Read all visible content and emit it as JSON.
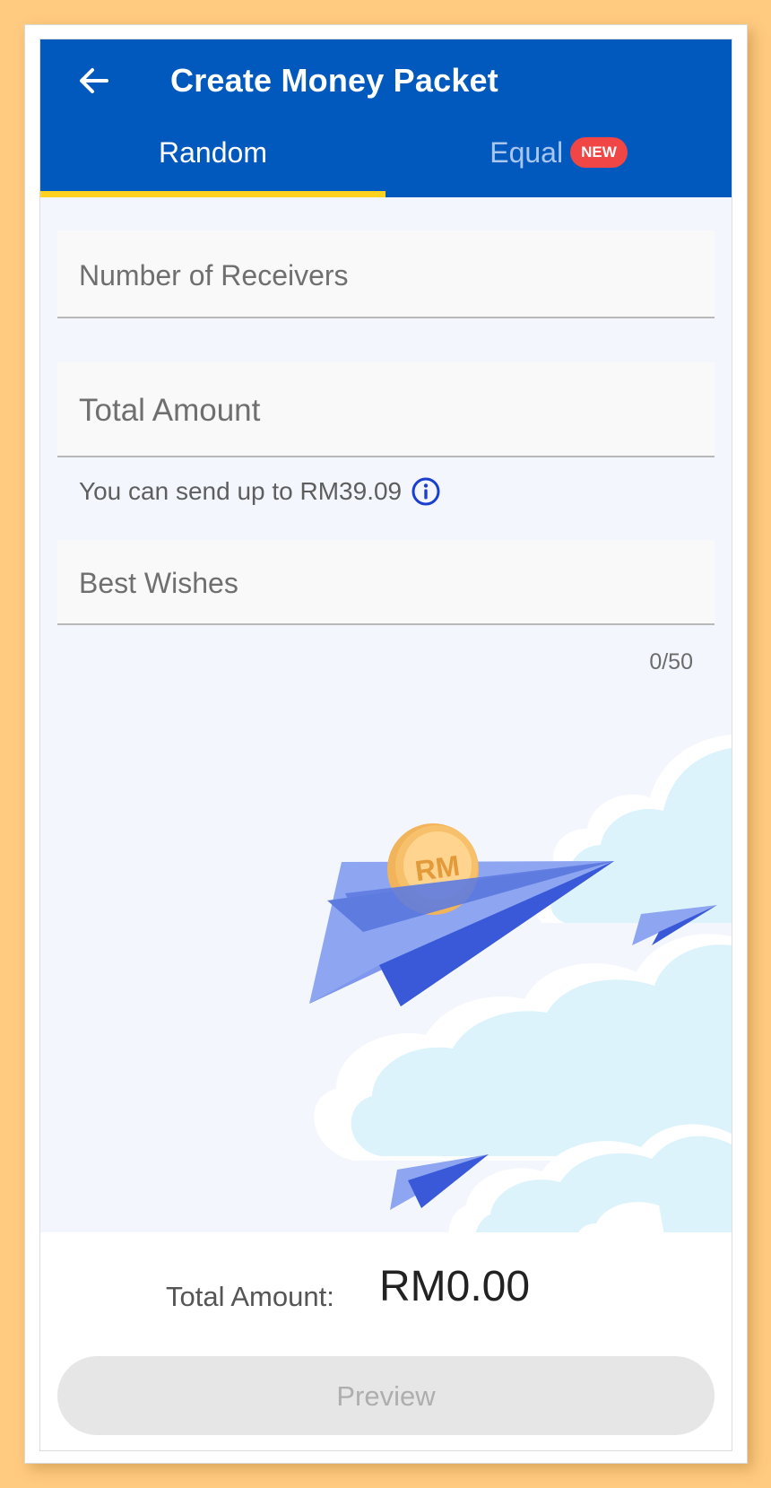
{
  "header": {
    "title": "Create Money Packet",
    "back_icon": "arrow-left-icon"
  },
  "tabs": [
    {
      "label": "Random",
      "active": true
    },
    {
      "label": "Equal",
      "active": false,
      "badge": "NEW"
    }
  ],
  "form": {
    "receivers_placeholder": "Number of Receivers",
    "amount_placeholder": "Total Amount",
    "amount_helper": "You can send up to RM39.09",
    "wishes_placeholder": "Best Wishes",
    "wishes_counter": "0/50"
  },
  "illustration": {
    "coin_text": "RM"
  },
  "footer": {
    "total_label": "Total Amount:",
    "total_value": "RM0.00",
    "preview_label": "Preview"
  },
  "colors": {
    "primary": "#0159BE",
    "tab_indicator": "#FFD21F",
    "badge": "#F04646",
    "background": "#F3F7FD",
    "outer_background": "#FFCB80"
  }
}
